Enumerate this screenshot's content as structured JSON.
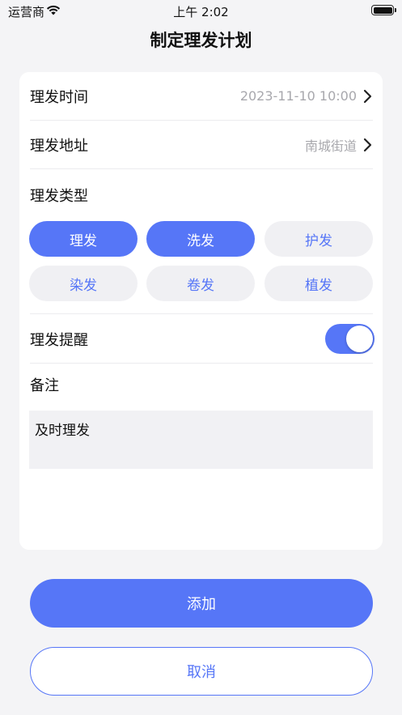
{
  "status_bar": {
    "carrier": "运营商",
    "time": "上午 2:02"
  },
  "header": {
    "title": "制定理发计划"
  },
  "form": {
    "time": {
      "label": "理发时间",
      "value": "2023-11-10 10:00"
    },
    "address": {
      "label": "理发地址",
      "value": "南城街道"
    },
    "type_label": "理发类型",
    "types": [
      {
        "label": "理发",
        "selected": true
      },
      {
        "label": "洗发",
        "selected": true
      },
      {
        "label": "护发",
        "selected": false
      },
      {
        "label": "染发",
        "selected": false
      },
      {
        "label": "卷发",
        "selected": false
      },
      {
        "label": "植发",
        "selected": false
      }
    ],
    "reminder": {
      "label": "理发提醒",
      "enabled": true
    },
    "note": {
      "label": "备注",
      "value": "及时理发"
    }
  },
  "actions": {
    "add_label": "添加",
    "cancel_label": "取消"
  },
  "colors": {
    "accent": "#5676f7",
    "background": "#f4f4f6",
    "chip_off": "#f0f0f3"
  }
}
